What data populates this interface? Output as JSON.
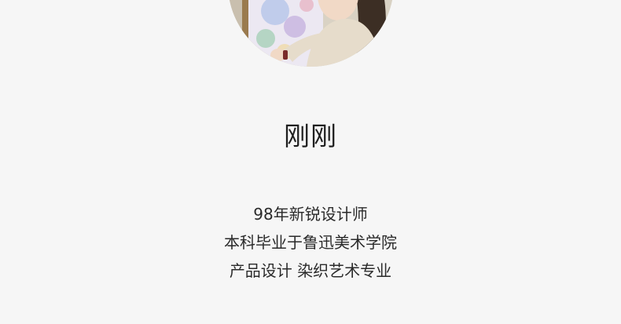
{
  "profile": {
    "name": "刚刚",
    "bio": [
      "98年新锐设计师",
      "本科毕业于鲁迅美术学院",
      "产品设计 染织艺术专业"
    ]
  },
  "colors": {
    "background": "#f6f6f6",
    "text": "#1f1f1f"
  }
}
